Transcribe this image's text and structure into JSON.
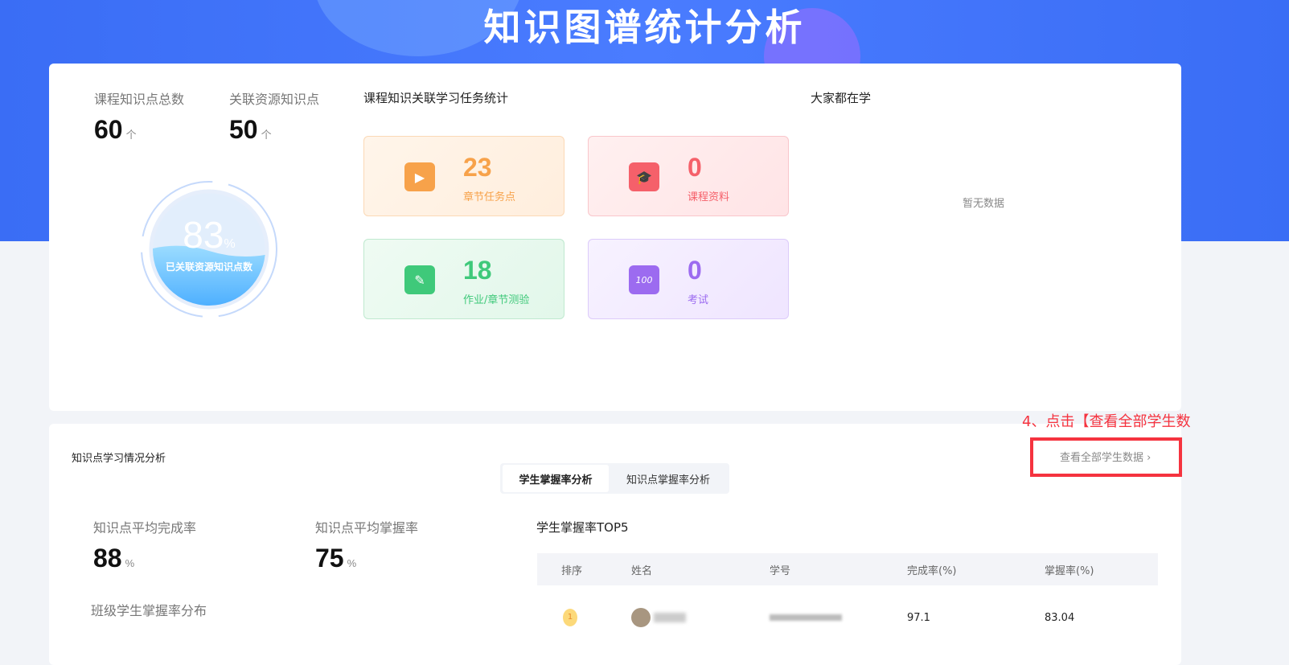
{
  "page_title": "知识图谱统计分析",
  "overview": {
    "total_label": "课程知识点总数",
    "total_value": "60",
    "total_unit": "个",
    "linked_label": "关联资源知识点",
    "linked_value": "50",
    "linked_unit": "个",
    "gauge_percent": "83",
    "gauge_percent_sign": "%",
    "gauge_label": "已关联资源知识点数"
  },
  "task_stats": {
    "title": "课程知识关联学习任务统计",
    "tiles": [
      {
        "value": "23",
        "label": "章节任务点",
        "color": "#f7a24a"
      },
      {
        "value": "0",
        "label": "课程资料",
        "color": "#f5606a"
      },
      {
        "value": "18",
        "label": "作业/章节测验",
        "color": "#3fc97a"
      },
      {
        "value": "0",
        "label": "考试",
        "color": "#9c6bf0"
      }
    ]
  },
  "learning": {
    "title": "大家都在学",
    "empty": "暂无数据"
  },
  "analysis": {
    "title": "知识点学习情况分析",
    "view_all": "查看全部学生数据",
    "annotation": "4、点击【查看全部学生数",
    "tabs": [
      "学生掌握率分析",
      "知识点掌握率分析"
    ],
    "avg_completion_label": "知识点平均完成率",
    "avg_completion": "88",
    "avg_completion_unit": "%",
    "avg_mastery_label": "知识点平均掌握率",
    "avg_mastery": "75",
    "avg_mastery_unit": "%",
    "distribution_label": "班级学生掌握率分布",
    "top5_title": "学生掌握率TOP5",
    "columns": [
      "排序",
      "姓名",
      "学号",
      "完成率(%)",
      "掌握率(%)"
    ],
    "rows": [
      {
        "rank": "1",
        "name": "",
        "id": "",
        "completion": "97.1",
        "mastery": "83.04"
      }
    ]
  }
}
